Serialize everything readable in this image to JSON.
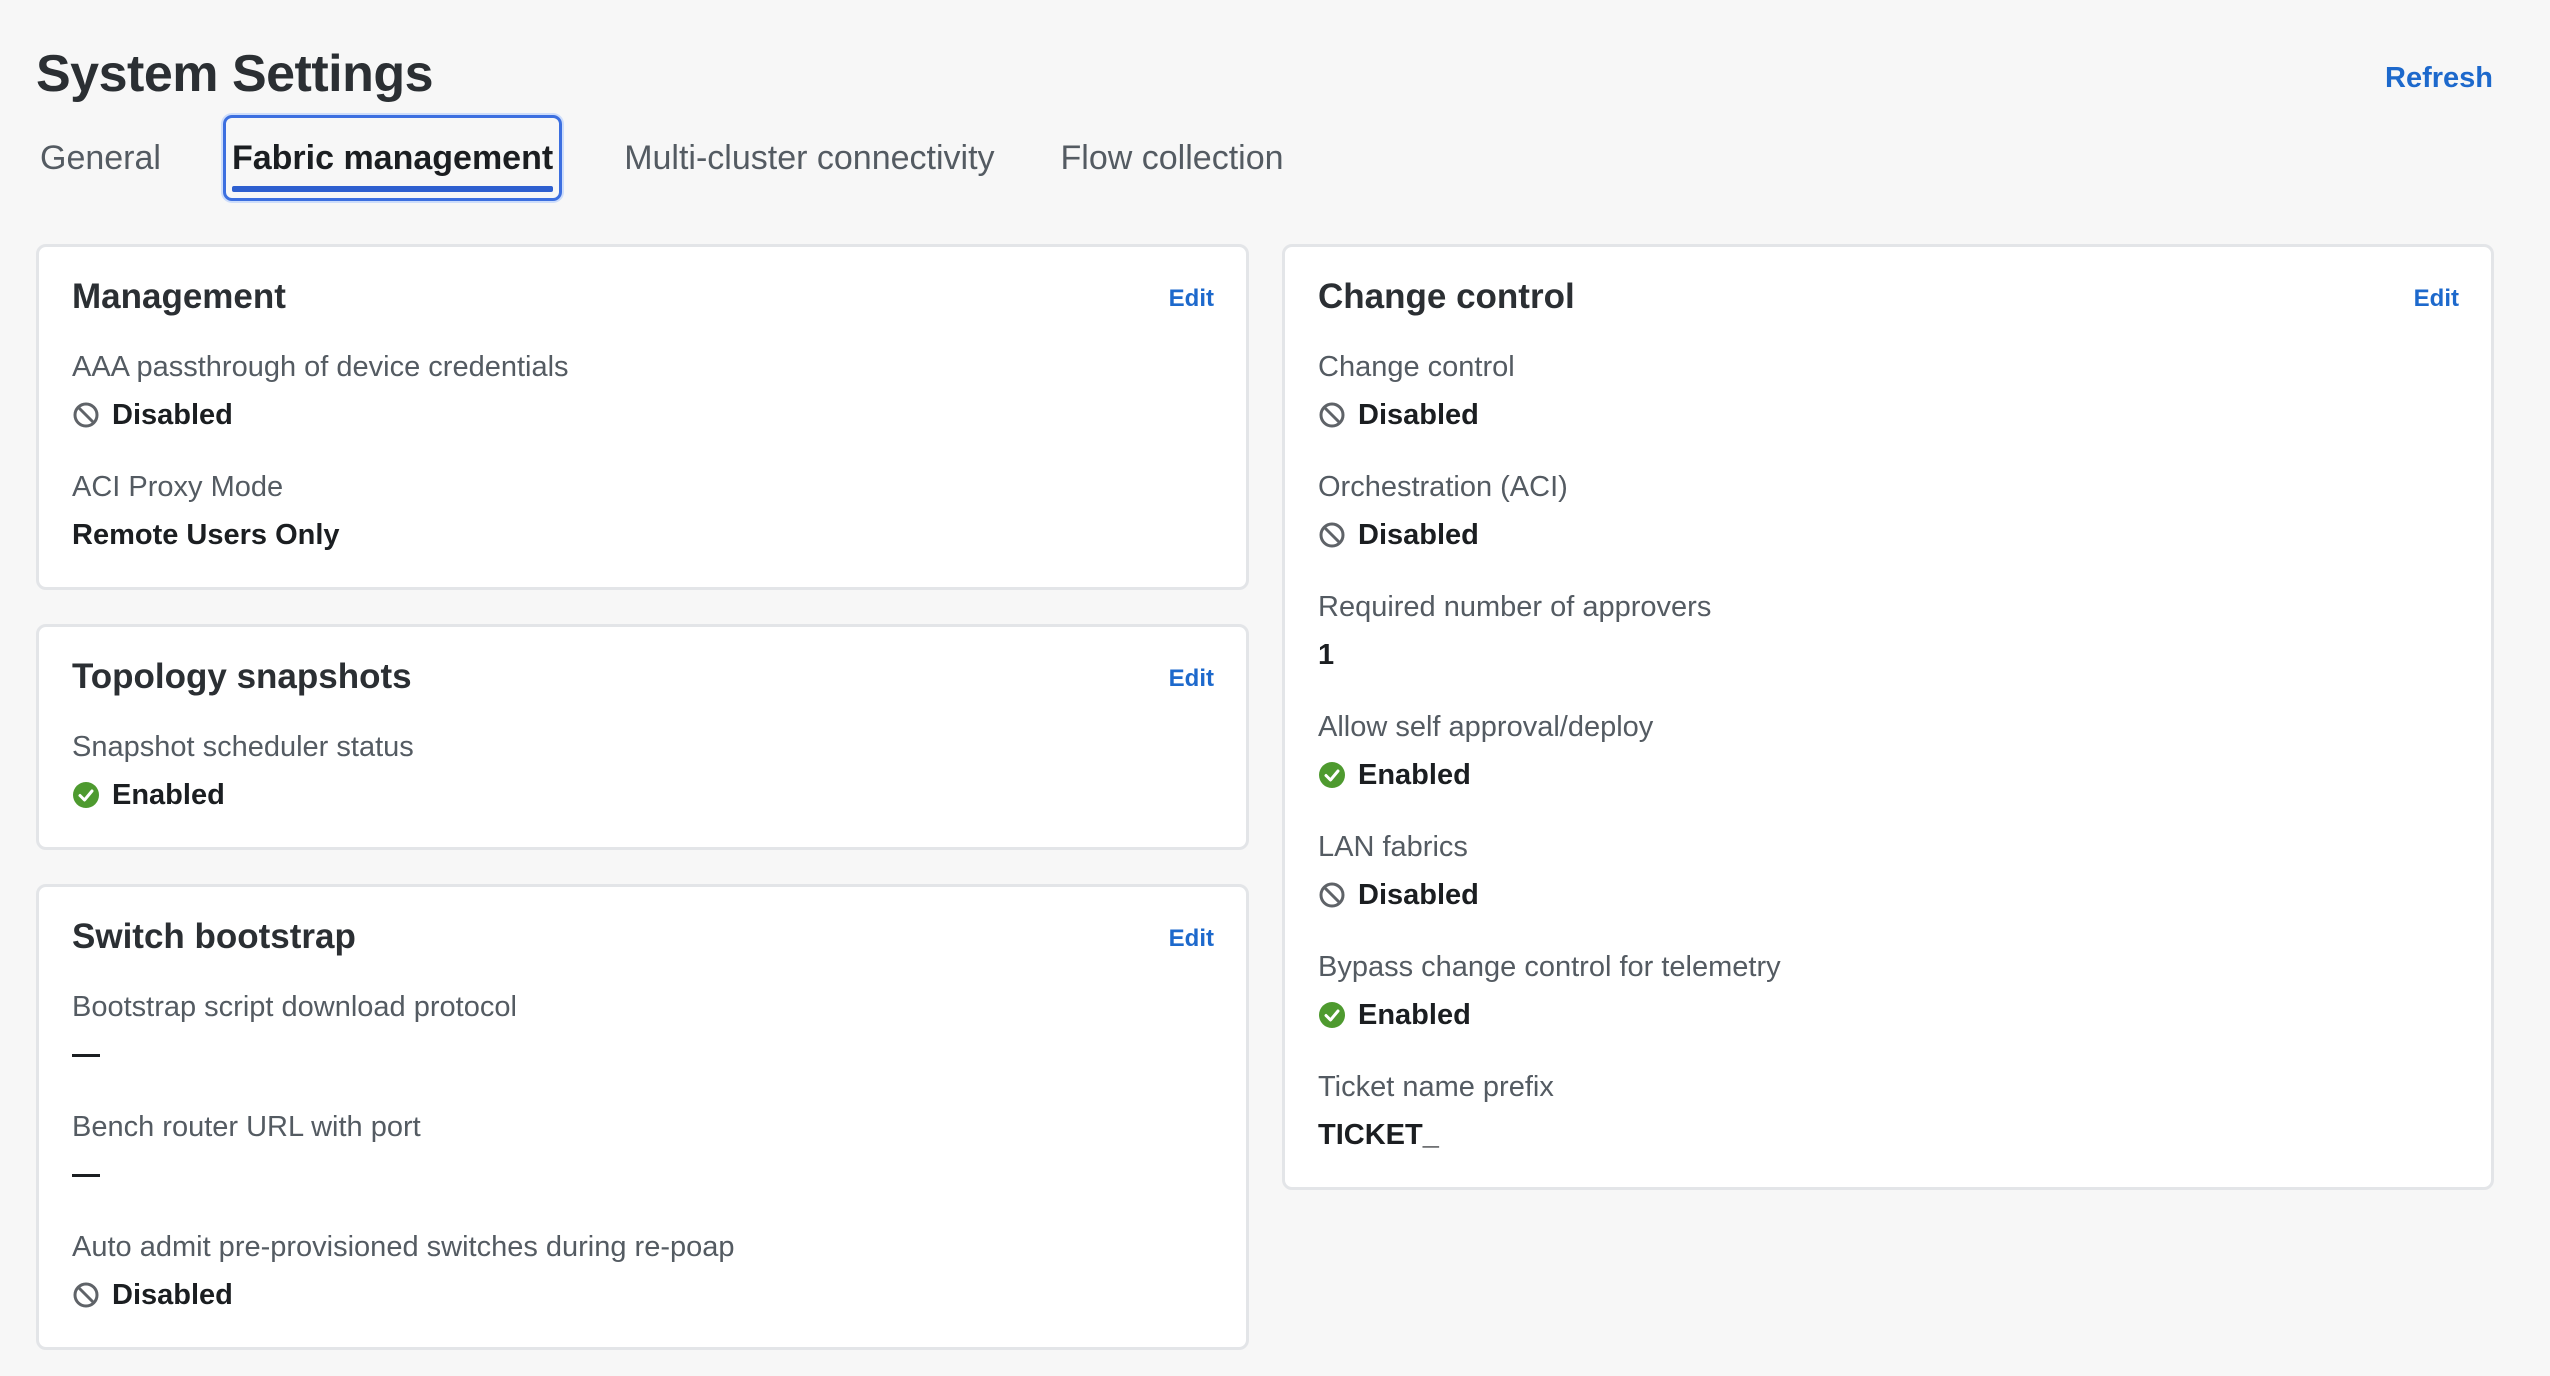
{
  "page": {
    "title": "System Settings",
    "refresh_label": "Refresh"
  },
  "tabs": [
    {
      "label": "General",
      "active": false
    },
    {
      "label": "Fabric management",
      "active": true
    },
    {
      "label": "Multi-cluster connectivity",
      "active": false
    },
    {
      "label": "Flow collection",
      "active": false
    }
  ],
  "colors": {
    "accent": "#1d69cc",
    "enabled": "#4e9a2f",
    "disabled": "#5f6368"
  },
  "cards": {
    "management": {
      "title": "Management",
      "edit_label": "Edit",
      "fields": [
        {
          "label": "AAA passthrough of device credentials",
          "value": "Disabled",
          "icon": "disabled-icon"
        },
        {
          "label": "ACI Proxy Mode",
          "value": "Remote Users Only",
          "icon": ""
        }
      ]
    },
    "topology": {
      "title": "Topology snapshots",
      "edit_label": "Edit",
      "fields": [
        {
          "label": "Snapshot scheduler status",
          "value": "Enabled",
          "icon": "enabled-icon"
        }
      ]
    },
    "bootstrap": {
      "title": "Switch bootstrap",
      "edit_label": "Edit",
      "fields": [
        {
          "label": "Bootstrap script download protocol",
          "value": "",
          "icon": "dash"
        },
        {
          "label": "Bench router URL with port",
          "value": "",
          "icon": "dash"
        },
        {
          "label": "Auto admit pre-provisioned switches during re-poap",
          "value": "Disabled",
          "icon": "disabled-icon"
        }
      ]
    },
    "change_control": {
      "title": "Change control",
      "edit_label": "Edit",
      "fields": [
        {
          "label": "Change control",
          "value": "Disabled",
          "icon": "disabled-icon"
        },
        {
          "label": "Orchestration (ACI)",
          "value": "Disabled",
          "icon": "disabled-icon"
        },
        {
          "label": "Required number of approvers",
          "value": "1",
          "icon": ""
        },
        {
          "label": "Allow self approval/deploy",
          "value": "Enabled",
          "icon": "enabled-icon"
        },
        {
          "label": "LAN fabrics",
          "value": "Disabled",
          "icon": "disabled-icon"
        },
        {
          "label": "Bypass change control for telemetry",
          "value": "Enabled",
          "icon": "enabled-icon"
        },
        {
          "label": "Ticket name prefix",
          "value": "TICKET_",
          "icon": ""
        }
      ]
    }
  }
}
